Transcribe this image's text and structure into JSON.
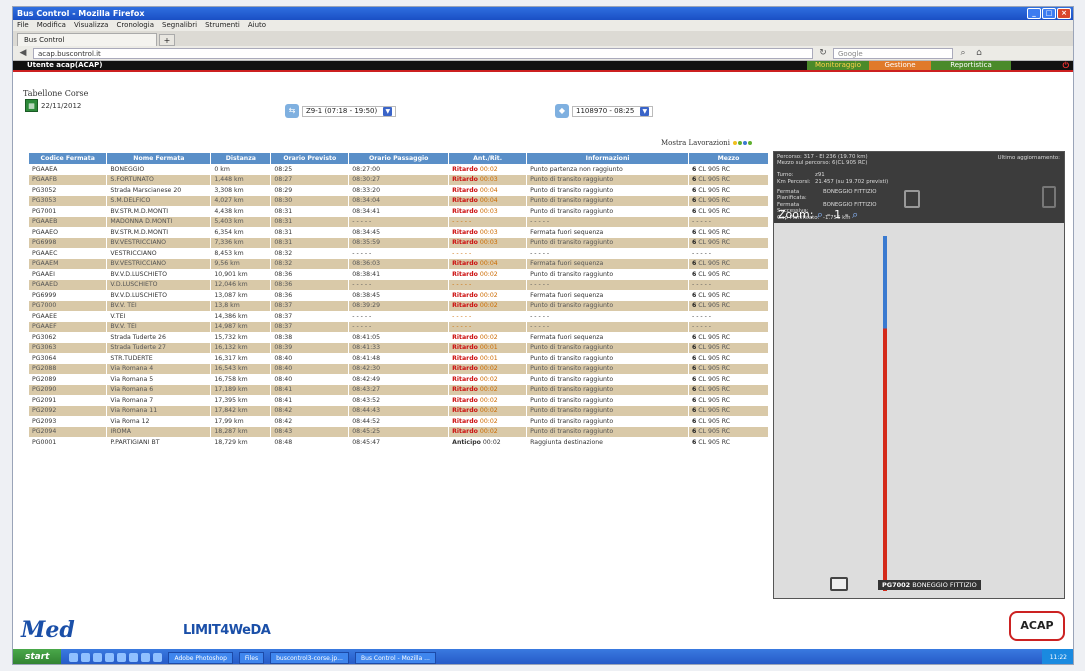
{
  "browser": {
    "window_title": "Bus Control - Mozilla Firefox",
    "menu": [
      "File",
      "Modifica",
      "Visualizza",
      "Cronologia",
      "Segnalibri",
      "Strumenti",
      "Aiuto"
    ],
    "tab_label": "Bus Control",
    "tab_new": "+",
    "url": "acap.buscontrol.it",
    "search_placeholder": "Google"
  },
  "app": {
    "user": "Utente acap(ACAP)",
    "nav": [
      "Monitoraggio",
      "Gestione",
      "Reportistica"
    ],
    "section_title": "Tabellone Corse",
    "date": "22/11/2012",
    "route_select": "Z9-1 (07:18 - 19:50)",
    "vehicle_select": "1108970 - 08:25",
    "legend_label": "Mostra Lavorazioni"
  },
  "table": {
    "headers": [
      "Codice Fermata",
      "Nome Fermata",
      "Distanza",
      "Orario Previsto",
      "Orario Passaggio",
      "Ant./Rit.",
      "Informazioni",
      "Mezzo"
    ],
    "rows": [
      {
        "code": "PGAAEA",
        "name": "BONEGGIO",
        "dist": "0 km",
        "prev": "08:25",
        "pass": "08:27:00",
        "ar_label": "Ritardo",
        "ar_val": "00:02",
        "info": "Punto partenza non raggiunto",
        "mz_n": "6",
        "mz": "CL 905 RC"
      },
      {
        "code": "PGAAFB",
        "name": "S.FORTUNATO",
        "dist": "1,448 km",
        "prev": "08:27",
        "pass": "08:30:27",
        "ar_label": "Ritardo",
        "ar_val": "00:03",
        "info": "Punto di transito raggiunto",
        "mz_n": "6",
        "mz": "CL 905 RC"
      },
      {
        "code": "PG3052",
        "name": "Strada Marscianese 20",
        "dist": "3,308 km",
        "prev": "08:29",
        "pass": "08:33:20",
        "ar_label": "Ritardo",
        "ar_val": "00:04",
        "info": "Punto di transito raggiunto",
        "mz_n": "6",
        "mz": "CL 905 RC"
      },
      {
        "code": "PG3053",
        "name": "S.M.DELFICO",
        "dist": "4,027 km",
        "prev": "08:30",
        "pass": "08:34:04",
        "ar_label": "Ritardo",
        "ar_val": "00:04",
        "info": "Punto di transito raggiunto",
        "mz_n": "6",
        "mz": "CL 905 RC"
      },
      {
        "code": "PG7001",
        "name": "BV.STR.M.D.MONTI",
        "dist": "4,438 km",
        "prev": "08:31",
        "pass": "08:34:41",
        "ar_label": "Ritardo",
        "ar_val": "00:03",
        "info": "Punto di transito raggiunto",
        "mz_n": "6",
        "mz": "CL 905 RC"
      },
      {
        "code": "PGAAEB",
        "name": "MADONNA D.MONTI",
        "dist": "5,403 km",
        "prev": "08:31",
        "pass": "- - - - -",
        "ar_label": "",
        "ar_val": "- - - - -",
        "info": "- - - - -",
        "mz_n": "",
        "mz": "- - - - -"
      },
      {
        "code": "PGAAEO",
        "name": "BV.STR.M.D.MONTI",
        "dist": "6,354 km",
        "prev": "08:31",
        "pass": "08:34:45",
        "ar_label": "Ritardo",
        "ar_val": "00:03",
        "info": "Fermata fuori sequenza",
        "mz_n": "6",
        "mz": "CL 905 RC"
      },
      {
        "code": "PG6998",
        "name": "BV.VESTRICCIANO",
        "dist": "7,336 km",
        "prev": "08:31",
        "pass": "08:35:59",
        "ar_label": "Ritardo",
        "ar_val": "00:03",
        "info": "Punto di transito raggiunto",
        "mz_n": "6",
        "mz": "CL 905 RC"
      },
      {
        "code": "PGAAEC",
        "name": "VESTRICCIANO",
        "dist": "8,453 km",
        "prev": "08:32",
        "pass": "- - - - -",
        "ar_label": "",
        "ar_val": "- - - - -",
        "info": "- - - - -",
        "mz_n": "",
        "mz": "- - - - -"
      },
      {
        "code": "PGAAEM",
        "name": "BV.VESTRICCIANO",
        "dist": "9,56 km",
        "prev": "08:32",
        "pass": "08:36:03",
        "ar_label": "Ritardo",
        "ar_val": "00:04",
        "info": "Fermata fuori sequenza",
        "mz_n": "6",
        "mz": "CL 905 RC"
      },
      {
        "code": "PGAAEI",
        "name": "BV.V.D.LUSCHIETO",
        "dist": "10,901 km",
        "prev": "08:36",
        "pass": "08:38:41",
        "ar_label": "Ritardo",
        "ar_val": "00:02",
        "info": "Punto di transito raggiunto",
        "mz_n": "6",
        "mz": "CL 905 RC"
      },
      {
        "code": "PGAAED",
        "name": "V.D.LUSCHIETO",
        "dist": "12,046 km",
        "prev": "08:36",
        "pass": "- - - - -",
        "ar_label": "",
        "ar_val": "- - - - -",
        "info": "- - - - -",
        "mz_n": "",
        "mz": "- - - - -"
      },
      {
        "code": "PG6999",
        "name": "BV.V.D.LUSCHIETO",
        "dist": "13,087 km",
        "prev": "08:36",
        "pass": "08:38:45",
        "ar_label": "Ritardo",
        "ar_val": "00:02",
        "info": "Fermata fuori sequenza",
        "mz_n": "6",
        "mz": "CL 905 RC"
      },
      {
        "code": "PG7000",
        "name": "BV.V. TEI",
        "dist": "13,8 km",
        "prev": "08:37",
        "pass": "08:39:29",
        "ar_label": "Ritardo",
        "ar_val": "00:02",
        "info": "Punto di transito raggiunto",
        "mz_n": "6",
        "mz": "CL 905 RC"
      },
      {
        "code": "PGAAEE",
        "name": "V.TEI",
        "dist": "14,386 km",
        "prev": "08:37",
        "pass": "- - - - -",
        "ar_label": "",
        "ar_val": "- - - - -",
        "info": "- - - - -",
        "mz_n": "",
        "mz": "- - - - -"
      },
      {
        "code": "PGAAEF",
        "name": "BV.V. TEI",
        "dist": "14,987 km",
        "prev": "08:37",
        "pass": "- - - - -",
        "ar_label": "",
        "ar_val": "- - - - -",
        "info": "- - - - -",
        "mz_n": "",
        "mz": "- - - - -"
      },
      {
        "code": "PG3062",
        "name": "Strada Tuderte 26",
        "dist": "15,732 km",
        "prev": "08:38",
        "pass": "08:41:05",
        "ar_label": "Ritardo",
        "ar_val": "00:02",
        "info": "Fermata fuori sequenza",
        "mz_n": "6",
        "mz": "CL 905 RC"
      },
      {
        "code": "PG3063",
        "name": "Strada Tuderte 27",
        "dist": "16,132 km",
        "prev": "08:39",
        "pass": "08:41:33",
        "ar_label": "Ritardo",
        "ar_val": "00:01",
        "info": "Punto di transito raggiunto",
        "mz_n": "6",
        "mz": "CL 905 RC"
      },
      {
        "code": "PG3064",
        "name": "STR.TUDERTE",
        "dist": "16,317 km",
        "prev": "08:40",
        "pass": "08:41:48",
        "ar_label": "Ritardo",
        "ar_val": "00:01",
        "info": "Punto di transito raggiunto",
        "mz_n": "6",
        "mz": "CL 905 RC"
      },
      {
        "code": "PG2088",
        "name": "Via Romana 4",
        "dist": "16,543 km",
        "prev": "08:40",
        "pass": "08:42:30",
        "ar_label": "Ritardo",
        "ar_val": "00:02",
        "info": "Punto di transito raggiunto",
        "mz_n": "6",
        "mz": "CL 905 RC"
      },
      {
        "code": "PG2089",
        "name": "Via Romana 5",
        "dist": "16,758 km",
        "prev": "08:40",
        "pass": "08:42:49",
        "ar_label": "Ritardo",
        "ar_val": "00:02",
        "info": "Punto di transito raggiunto",
        "mz_n": "6",
        "mz": "CL 905 RC"
      },
      {
        "code": "PG2090",
        "name": "Via Romana 6",
        "dist": "17,189 km",
        "prev": "08:41",
        "pass": "08:43:27",
        "ar_label": "Ritardo",
        "ar_val": "00:02",
        "info": "Punto di transito raggiunto",
        "mz_n": "6",
        "mz": "CL 905 RC"
      },
      {
        "code": "PG2091",
        "name": "Via Romana 7",
        "dist": "17,395 km",
        "prev": "08:41",
        "pass": "08:43:52",
        "ar_label": "Ritardo",
        "ar_val": "00:02",
        "info": "Punto di transito raggiunto",
        "mz_n": "6",
        "mz": "CL 905 RC"
      },
      {
        "code": "PG2092",
        "name": "Via Romana 11",
        "dist": "17,842 km",
        "prev": "08:42",
        "pass": "08:44:43",
        "ar_label": "Ritardo",
        "ar_val": "00:02",
        "info": "Punto di transito raggiunto",
        "mz_n": "6",
        "mz": "CL 905 RC"
      },
      {
        "code": "PG2093",
        "name": "Via Roma 12",
        "dist": "17,99 km",
        "prev": "08:42",
        "pass": "08:44:52",
        "ar_label": "Ritardo",
        "ar_val": "00:02",
        "info": "Punto di transito raggiunto",
        "mz_n": "6",
        "mz": "CL 905 RC"
      },
      {
        "code": "PG2094",
        "name": "IROMA",
        "dist": "18,287 km",
        "prev": "08:43",
        "pass": "08:45:25",
        "ar_label": "Ritardo",
        "ar_val": "00:02",
        "info": "Punto di transito raggiunto",
        "mz_n": "6",
        "mz": "CL 905 RC"
      },
      {
        "code": "PG0001",
        "name": "P.PARTIGIANI BT",
        "dist": "18,729 km",
        "prev": "08:48",
        "pass": "08:45:47",
        "ar_label": "Anticipo",
        "ar_val": "00:02",
        "info": "Raggiunta destinazione",
        "mz_n": "6",
        "mz": "CL 905 RC"
      }
    ]
  },
  "map": {
    "line1": "Percorso: 317 - El 236 (19.70 km)",
    "line2": "Mezzo sul percorso: 6(CL 905 RC)",
    "last_update": "Ultimo aggiornamento:",
    "turno_label": "Turno:",
    "turno_val": "z91",
    "km_label": "Km Percorsi:",
    "km_val": "21.457 (su 19.702 previsti)",
    "fp_label": "Fermata Pianificata:",
    "fp_val": "BONEGGIO FITTIZIO",
    "fs_label": "Fermata Successiva:",
    "fs_val": "BONEGGIO FITTIZIO",
    "gap_label": "Gap Pianificato:",
    "gap_val": "-1.755 km",
    "zoom": "Zoom:",
    "zoom_level": "1",
    "stop_code": "PG7002",
    "stop_name": "BONEGGIO FITTIZIO"
  },
  "footer": {
    "logo1": "Med",
    "logo2": "LIMIT4WeDA",
    "logo3": "ACAP"
  },
  "taskbar": {
    "start": "start",
    "tasks": [
      "Adobe Photoshop",
      "Files",
      "buscontrol3-corse.jp...",
      "Bus Control - Mozilla ..."
    ],
    "clock": "11:22"
  }
}
